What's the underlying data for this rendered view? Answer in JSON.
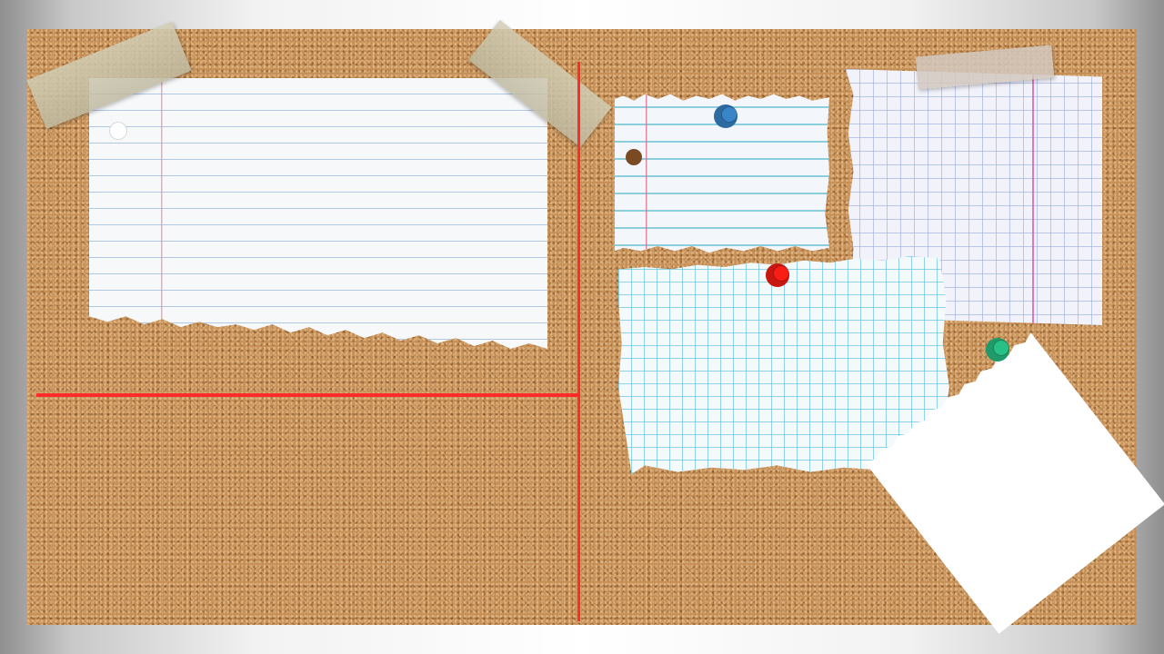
{
  "board": {
    "material": "cork",
    "frame_colors": [
      "#8f8f8f",
      "#ffffff"
    ],
    "cork_color": "#c58f56"
  },
  "guides": {
    "color": "#ff2a2a"
  },
  "notes": [
    {
      "kind": "torn-lined-paper",
      "icon": "lined-paper-icon",
      "text": ""
    },
    {
      "kind": "torn-lined-paper-small",
      "icon": "lined-paper-icon",
      "text": ""
    },
    {
      "kind": "graph-paper-violet",
      "icon": "graph-paper-icon",
      "text": ""
    },
    {
      "kind": "graph-paper-cyan",
      "icon": "graph-paper-icon",
      "text": ""
    },
    {
      "kind": "blank-white-sheet",
      "icon": "paper-sheet-icon",
      "text": ""
    }
  ],
  "pins": [
    {
      "color": "#2d6aa0",
      "icon": "push-pin-icon"
    },
    {
      "color": "#c8170f",
      "icon": "push-pin-icon"
    },
    {
      "color": "#1f9a6a",
      "icon": "push-pin-icon"
    }
  ],
  "tape": {
    "color": "#cfcab0",
    "icon": "masking-tape-icon"
  }
}
